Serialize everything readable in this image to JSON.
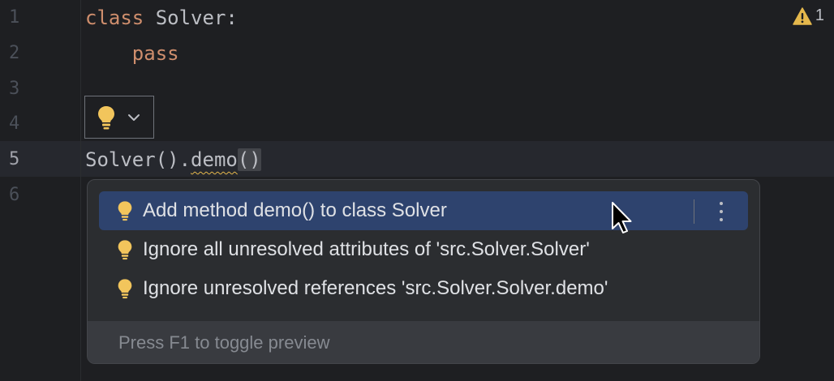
{
  "gutter": {
    "line_numbers": [
      "1",
      "2",
      "3",
      "4",
      "5",
      "6"
    ],
    "active_line": "5"
  },
  "code": {
    "line1": {
      "keyword": "class",
      "rest": " Solver:"
    },
    "line2": {
      "indent": "    ",
      "keyword": "pass"
    },
    "line5": {
      "prefix": "Solver().",
      "unresolved": "demo",
      "parens": "()"
    }
  },
  "warnings": {
    "icon": "warning-triangle-icon",
    "count": "1"
  },
  "intention_button": {
    "icon": "lightbulb-icon",
    "dropdown_icon": "chevron-down-icon"
  },
  "popup": {
    "items": [
      {
        "label": "Add method demo() to class Solver",
        "icon": "lightbulb-icon",
        "selected": true
      },
      {
        "label": "Ignore all unresolved attributes of 'src.Solver.Solver'",
        "icon": "lightbulb-icon"
      },
      {
        "label": "Ignore unresolved references 'src.Solver.Solver.demo'",
        "icon": "lightbulb-icon"
      }
    ],
    "more_icon": "vertical-ellipsis-icon",
    "footer": "Press F1 to toggle preview"
  },
  "colors": {
    "background": "#1e1f22",
    "keyword": "#cf8e6d",
    "selection": "#2e436e",
    "warning": "#e5b84c"
  }
}
